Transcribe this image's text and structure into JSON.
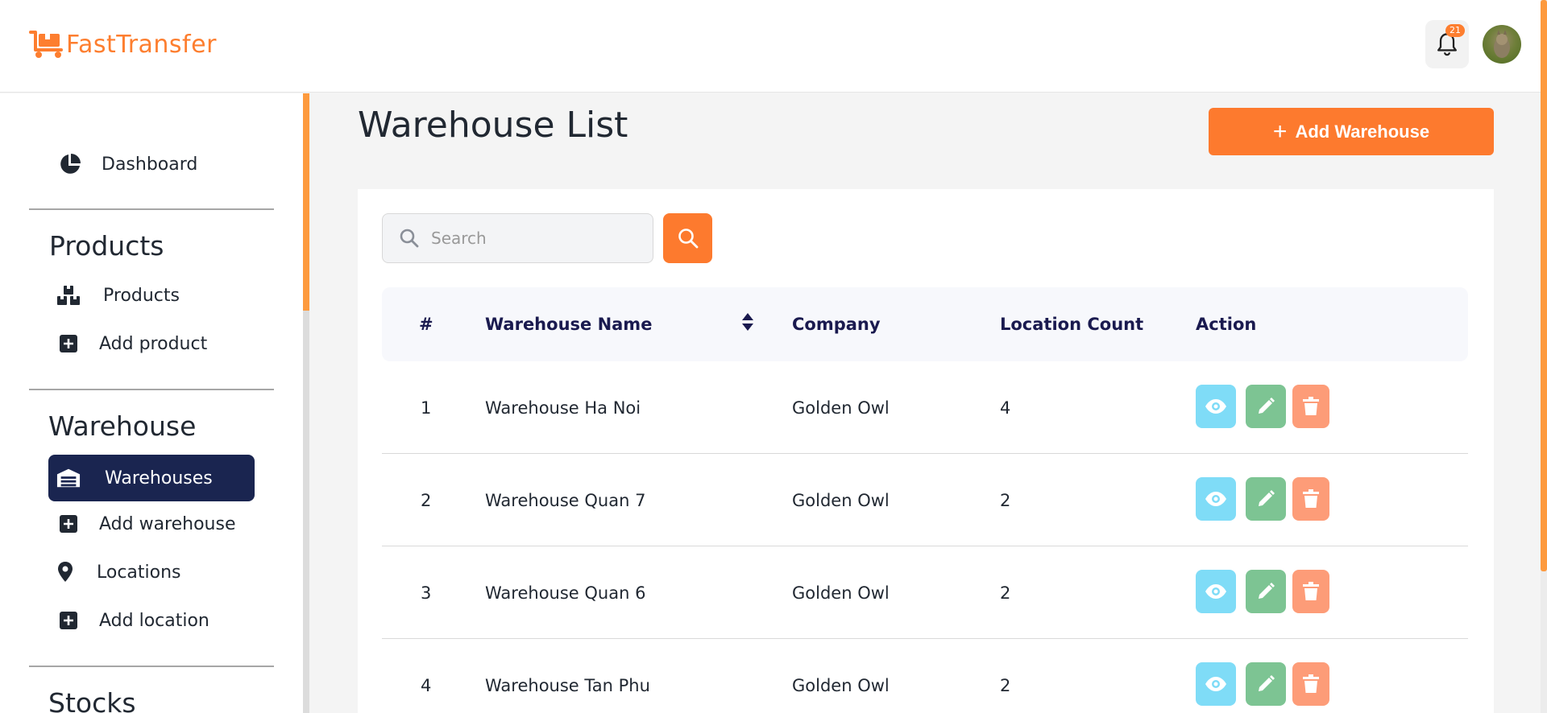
{
  "app": {
    "name": "FastTransfer",
    "notification_count": "21"
  },
  "sidebar": {
    "dashboard": "Dashboard",
    "sections": [
      {
        "title": "Products",
        "items": [
          {
            "label": "Products",
            "icon": "boxes-icon"
          },
          {
            "label": "Add product",
            "icon": "plus-square-icon"
          }
        ]
      },
      {
        "title": "Warehouse",
        "items": [
          {
            "label": "Warehouses",
            "icon": "warehouse-icon",
            "active": true
          },
          {
            "label": "Add warehouse",
            "icon": "plus-square-icon"
          },
          {
            "label": "Locations",
            "icon": "map-pin-icon"
          },
          {
            "label": "Add location",
            "icon": "plus-square-icon"
          }
        ]
      },
      {
        "title": "Stocks",
        "items": []
      }
    ]
  },
  "main": {
    "title": "Warehouse List",
    "add_button": "Add Warehouse",
    "search": {
      "placeholder": "Search",
      "value": ""
    },
    "table": {
      "columns": [
        "#",
        "Warehouse Name",
        "Company",
        "Location Count",
        "Action"
      ],
      "rows": [
        {
          "index": "1",
          "name": "Warehouse Ha Noi",
          "company": "Golden Owl",
          "count": "4"
        },
        {
          "index": "2",
          "name": "Warehouse Quan 7",
          "company": "Golden Owl",
          "count": "2"
        },
        {
          "index": "3",
          "name": "Warehouse Quan 6",
          "company": "Golden Owl",
          "count": "2"
        },
        {
          "index": "4",
          "name": "Warehouse Tan Phu",
          "company": "Golden Owl",
          "count": "2"
        }
      ]
    }
  },
  "colors": {
    "accent": "#fd7a2e",
    "nav_active": "#1a2550",
    "view": "#7fdcf7",
    "edit": "#7dc493",
    "delete": "#fd9c78"
  }
}
